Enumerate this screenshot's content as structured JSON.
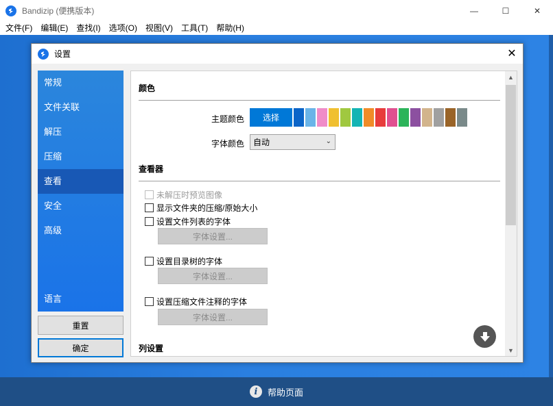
{
  "window": {
    "title": "Bandizip (便携版本)",
    "minimize": "—",
    "maximize": "☐",
    "close": "✕"
  },
  "menu": [
    "文件(F)",
    "编辑(E)",
    "查找(I)",
    "选项(O)",
    "视图(V)",
    "工具(T)",
    "帮助(H)"
  ],
  "dialog": {
    "title": "设置",
    "close": "✕",
    "nav": [
      "常规",
      "文件关联",
      "解压",
      "压缩",
      "查看",
      "安全",
      "高级"
    ],
    "nav_lang": "语言",
    "active_nav": "查看",
    "reset_button": "重置",
    "ok_button": "确定"
  },
  "content": {
    "color_section": "颜色",
    "theme_color_label": "主题颜色",
    "select_button": "选择",
    "swatch_colors": [
      "#0a64c8",
      "#6ab4e8",
      "#f08cc8",
      "#f0c030",
      "#a0c840",
      "#14b4b4",
      "#f08c28",
      "#e83c3c",
      "#e05090",
      "#2cb45a",
      "#8c50a0",
      "#d2b48c",
      "#a0a0a0",
      "#9a6428",
      "#7a8a8a"
    ],
    "font_color_label": "字体颜色",
    "font_color_value": "自动",
    "viewer_section": "查看器",
    "checkboxes": [
      {
        "label": "未解压时预览图像",
        "disabled": true
      },
      {
        "label": "显示文件夹的压缩/原始大小",
        "disabled": false
      },
      {
        "label": "设置文件列表的字体",
        "disabled": false
      },
      {
        "label": "设置目录树的字体",
        "disabled": false
      },
      {
        "label": "设置压缩文件注释的字体",
        "disabled": false
      }
    ],
    "font_settings_button": "字体设置...",
    "columns_section": "列设置"
  },
  "bottom": {
    "help_label": "帮助页面"
  }
}
